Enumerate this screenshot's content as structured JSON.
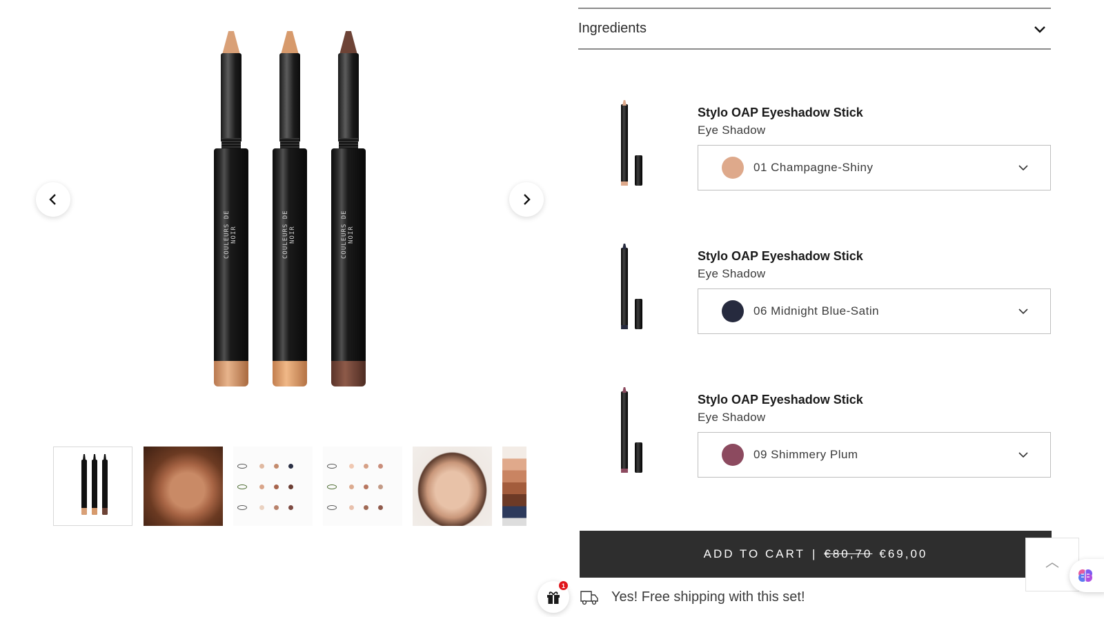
{
  "gallery": {
    "brand_text": "COULEURS DE NOIR",
    "pencil_colors": [
      "#d9a077",
      "#d79a6c",
      "#6d4336"
    ],
    "prev_icon": "chevron-left-icon",
    "next_icon": "chevron-right-icon",
    "thumbnails": [
      "product-trio",
      "model-portrait-1",
      "shade-chart-1",
      "shade-chart-2",
      "model-portrait-2",
      "palette-partial"
    ]
  },
  "ingredients": {
    "label": "Ingredients",
    "icon": "chevron-down-icon"
  },
  "items": [
    {
      "title": "Stylo OAP Eyeshadow Stick",
      "subtitle": "Eye Shadow",
      "shade": "01 Champagne-Shiny",
      "swatch_color": "#dea98b"
    },
    {
      "title": "Stylo OAP Eyeshadow Stick",
      "subtitle": "Eye Shadow",
      "shade": "06 Midnight Blue-Satin",
      "swatch_color": "#262a3e"
    },
    {
      "title": "Stylo OAP Eyeshadow Stick",
      "subtitle": "Eye Shadow",
      "shade": "09 Shimmery Plum",
      "swatch_color": "#8c4a5f"
    }
  ],
  "cart": {
    "label": "ADD TO CART",
    "separator": "|",
    "old_price": "€80,70",
    "price": "€69,00"
  },
  "shipping": {
    "text": "Yes! Free shipping with this set!",
    "icon": "truck-icon"
  },
  "gift": {
    "badge_count": "1",
    "icon": "gift-icon"
  },
  "widgets": {
    "scroll_top_icon": "chevron-up-icon",
    "ai_icon": "brain-icon"
  },
  "colors": {
    "cart_bg": "#2e2e2e",
    "badge": "#e0151b"
  }
}
